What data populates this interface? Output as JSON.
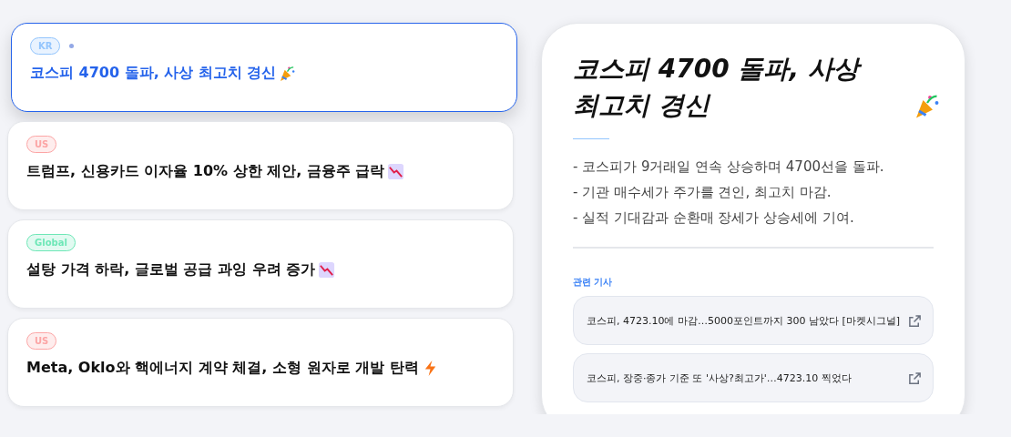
{
  "news": [
    {
      "region": "KR",
      "color": "#93c5fd",
      "title": "코스피 4700 돌파, 사상 최고치 경신",
      "kind": "party",
      "selected": true
    },
    {
      "region": "US",
      "color": "#fca5a5",
      "title": "트럼프, 신용카드 이자율 10% 상한 제안, 금융주 급락",
      "kind": "chart-down",
      "selected": false
    },
    {
      "region": "Global",
      "color": "#6ee7b7",
      "title": "설탕 가격 하락, 글로벌 공급 과잉 우려 증가",
      "kind": "chart-down",
      "selected": false
    },
    {
      "region": "US",
      "color": "#fca5a5",
      "title": "Meta, Oklo와 핵에너지 계약 체결, 소형 원자로 개발 탄력",
      "kind": "bolt",
      "selected": false
    }
  ],
  "detail": {
    "title": "코스피 4700 돌파, 사상 최고치 경신",
    "kind": "party",
    "summary": [
      "- 코스피가 9거래일 연속 상승하며 4700선을 돌파.",
      "- 기관 매수세가 주가를 견인, 최고치 마감.",
      "- 실적 기대감과 순환매 장세가 상승세에 기여."
    ],
    "related_label": "관련 기사",
    "related": [
      "코스피, 4723.10에 마감…5000포인트까지 300 남았다 [마켓시그널]",
      "코스피, 장중·종가 기준 또 '사상?최고가'…4723.10 찍었다"
    ]
  }
}
